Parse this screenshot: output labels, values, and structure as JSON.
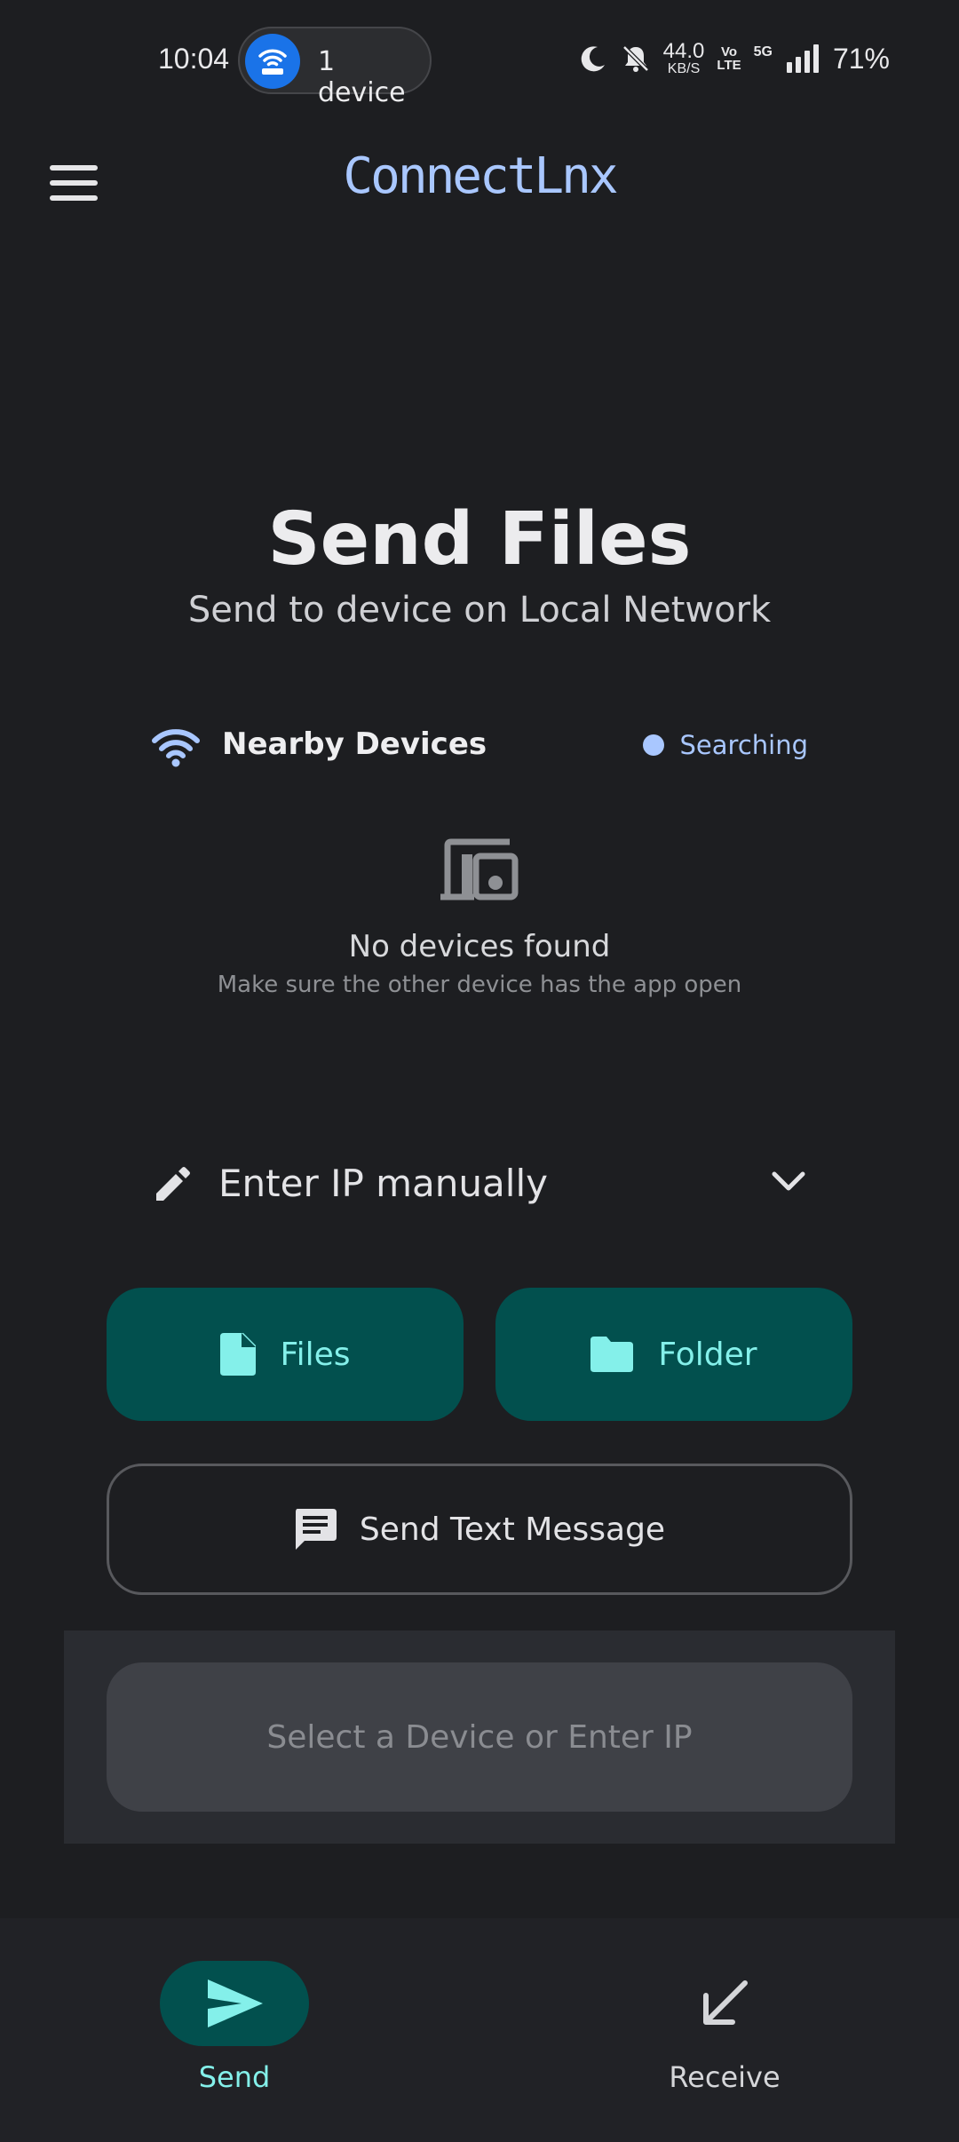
{
  "status_bar": {
    "time": "10:04",
    "hotspot_label": "1 device",
    "net_speed_value": "44.0",
    "net_speed_unit": "KB/S",
    "volte_top": "Vo",
    "volte_bottom": "LTE",
    "network_type": "5G",
    "battery": "71%",
    "icons": [
      "hotspot-icon",
      "moon-icon",
      "mute-icon",
      "signal-icon"
    ]
  },
  "app_bar": {
    "title": "ConnectLnx",
    "menu_icon": "menu-icon"
  },
  "colors": {
    "accent": "#a9c7ff",
    "tonal_bg": "#02504e",
    "tonal_fg": "#84f0ea",
    "background": "#1d1e21"
  },
  "main": {
    "heading": "Send Files",
    "subheading": "Send to device on Local Network",
    "nearby": {
      "label": "Nearby Devices",
      "status": "Searching",
      "icon": "wifi-icon"
    },
    "empty_state": {
      "title": "No devices found",
      "subtitle": "Make sure the other device has the app open",
      "icon": "devices-icon"
    },
    "manual_ip": {
      "label": "Enter IP manually",
      "icon": "pencil-icon",
      "toggle_icon": "chevron-down-icon"
    },
    "buttons": {
      "files": "Files",
      "folder": "Folder",
      "text_message": "Send Text Message",
      "primary_disabled": "Select a Device or Enter IP"
    }
  },
  "bottom_nav": {
    "items": [
      {
        "label": "Send",
        "icon": "send-icon",
        "active": true
      },
      {
        "label": "Receive",
        "icon": "arrow-down-left-icon",
        "active": false
      }
    ]
  }
}
